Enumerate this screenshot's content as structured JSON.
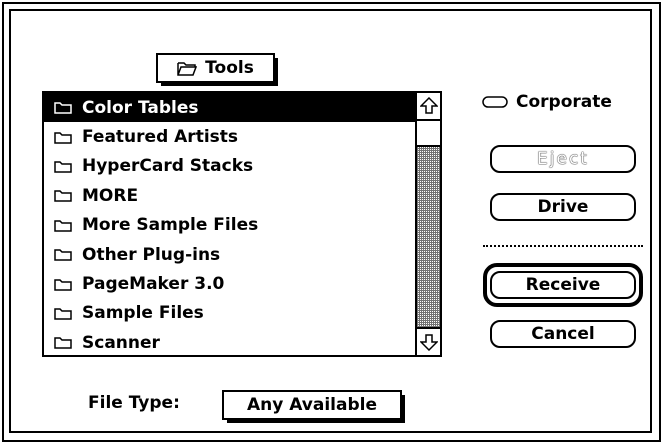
{
  "current_folder": {
    "label": "Tools",
    "icon": "open-folder-icon"
  },
  "file_list": {
    "items": [
      {
        "label": "Color Tables",
        "icon": "folder-icon",
        "selected": true
      },
      {
        "label": "Featured Artists",
        "icon": "folder-icon",
        "selected": false
      },
      {
        "label": "HyperCard Stacks",
        "icon": "folder-icon",
        "selected": false
      },
      {
        "label": "MORE",
        "icon": "folder-icon",
        "selected": false
      },
      {
        "label": "More Sample Files",
        "icon": "folder-icon",
        "selected": false
      },
      {
        "label": "Other Plug-ins",
        "icon": "folder-icon",
        "selected": false
      },
      {
        "label": "PageMaker 3.0",
        "icon": "folder-icon",
        "selected": false
      },
      {
        "label": "Sample Files",
        "icon": "folder-icon",
        "selected": false
      },
      {
        "label": "Scanner",
        "icon": "folder-icon",
        "selected": false
      }
    ]
  },
  "volume": {
    "label": "Corporate",
    "icon": "disk-icon"
  },
  "buttons": {
    "eject": {
      "label": "Eject",
      "enabled": false
    },
    "drive": {
      "label": "Drive"
    },
    "receive": {
      "label": "Receive",
      "default": true
    },
    "cancel": {
      "label": "Cancel"
    }
  },
  "file_type": {
    "label": "File Type:",
    "value": "Any Available"
  }
}
